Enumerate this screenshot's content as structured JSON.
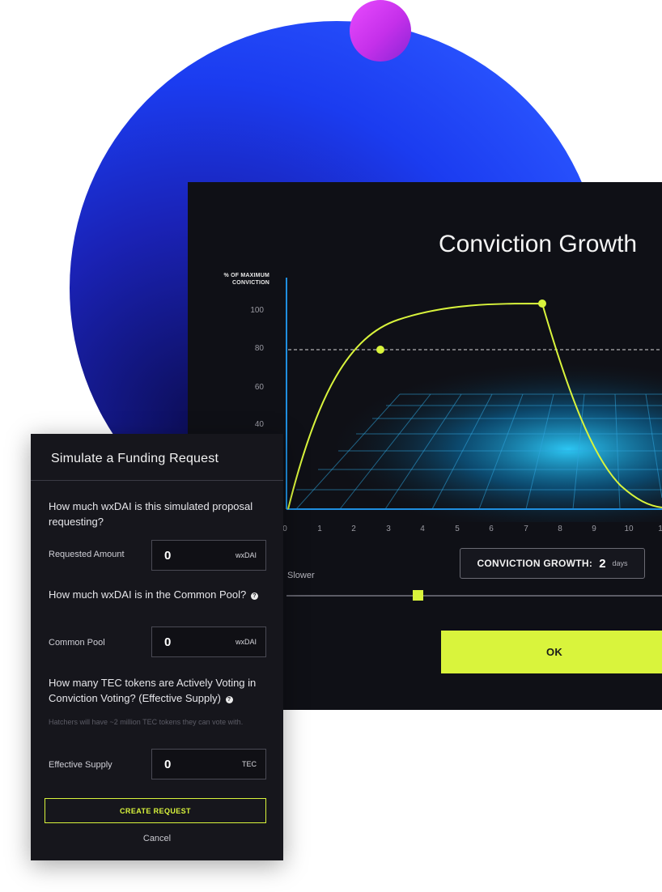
{
  "chart": {
    "title": "Conviction Growth",
    "yaxis_label_line1": "% OF MAXIMUM",
    "yaxis_label_line2": "CONVICTION",
    "yticks": [
      "100",
      "80",
      "60",
      "40"
    ],
    "xticks": [
      "0",
      "1",
      "2",
      "3",
      "4",
      "5",
      "6",
      "7",
      "8",
      "9",
      "10",
      "1"
    ]
  },
  "growth": {
    "label": "CONVICTION GROWTH:",
    "value": "2",
    "unit": "days",
    "slider_label": "Slower"
  },
  "ok_label": "OK",
  "form": {
    "title": "Simulate a Funding Request",
    "q1": "How much wxDAI is this simulated proposal requesting?",
    "q2": "How much wxDAI is in the Common Pool?",
    "q3": "How many TEC tokens are Actively Voting in Conviction Voting? (Effective Supply)",
    "help_glyph": "?",
    "hint": "Hatchers will have ~2 million TEC tokens they can vote with.",
    "fields": [
      {
        "label": "Requested Amount",
        "value": "0",
        "unit": "wxDAI"
      },
      {
        "label": "Common Pool",
        "value": "0",
        "unit": "wxDAI"
      },
      {
        "label": "Effective Supply",
        "value": "0",
        "unit": "TEC"
      }
    ],
    "create_label": "CREATE REQUEST",
    "cancel_label": "Cancel"
  },
  "colors": {
    "accent": "#d9f43c",
    "axis": "#1f8fe0",
    "gradient_blue": "#1b3cf0",
    "pink": "#e94bff"
  }
}
